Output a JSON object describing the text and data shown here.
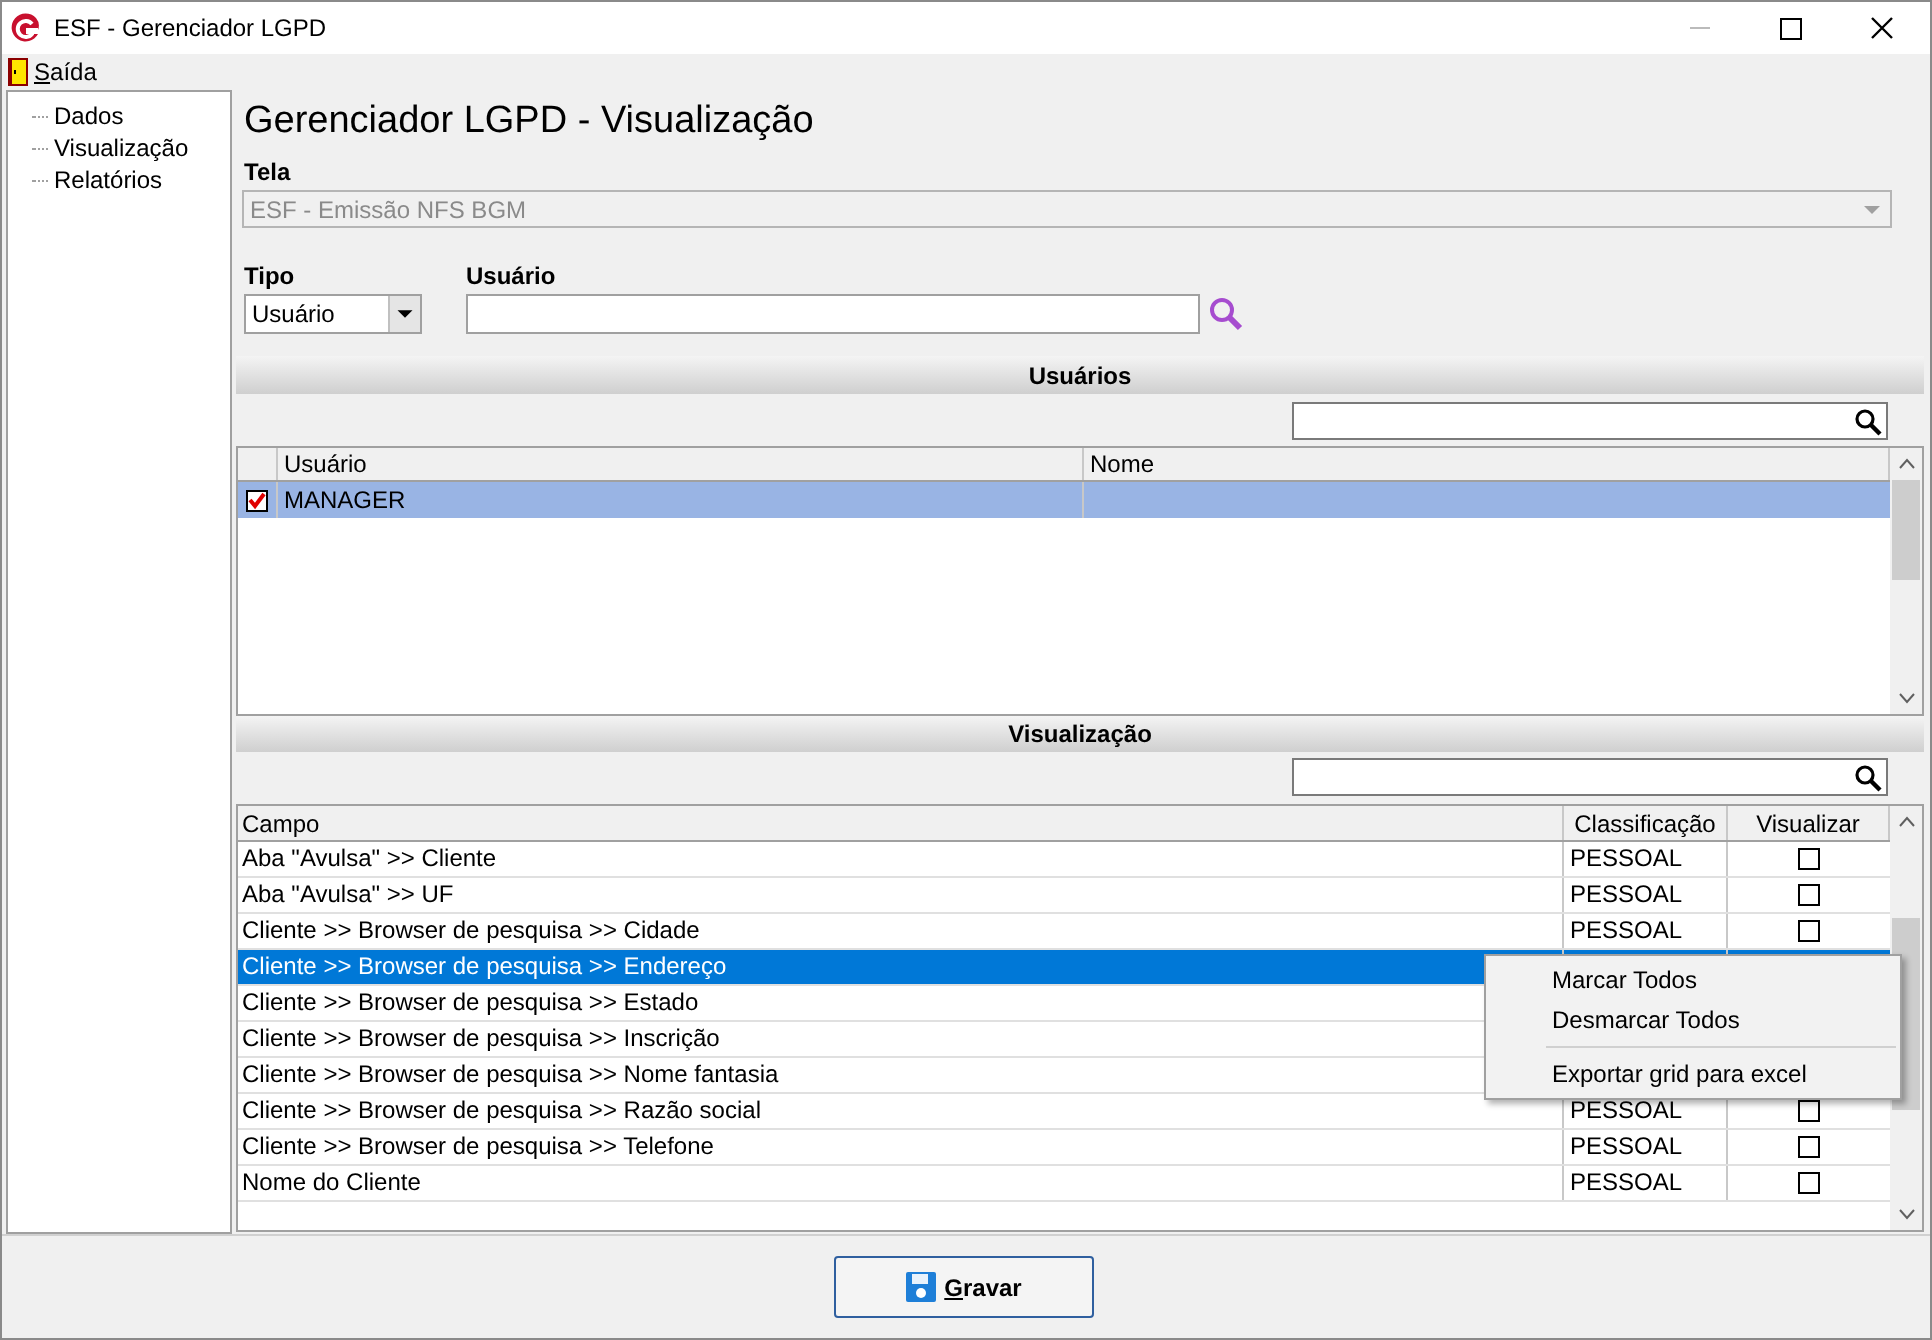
{
  "window": {
    "title": "ESF - Gerenciador LGPD"
  },
  "menu": [
    {
      "label": "Saída"
    }
  ],
  "sidebar": {
    "items": [
      {
        "label": "Dados"
      },
      {
        "label": "Visualização"
      },
      {
        "label": "Relatórios"
      }
    ]
  },
  "heading": "Gerenciador LGPD - Visualização",
  "tela": {
    "label": "Tela",
    "value": "ESF - Emissão NFS BGM",
    "disabled": true
  },
  "tipo": {
    "label": "Tipo",
    "value": "Usuário"
  },
  "usuario": {
    "label": "Usuário"
  },
  "usuarios_section": {
    "title": "Usuários",
    "columns": [
      "Usuário",
      "Nome"
    ],
    "rows": [
      {
        "usuario": "MANAGER",
        "checked": true,
        "selected": true
      }
    ]
  },
  "visualizacao_section": {
    "title": "Visualização",
    "columns": [
      "Campo",
      "Classificação",
      "Visualizar"
    ],
    "rows": [
      {
        "campo": "Aba \"Avulsa\" >> Cliente",
        "classificacao": "PESSOAL",
        "visualizar": false,
        "selected": false
      },
      {
        "campo": "Aba \"Avulsa\" >> UF",
        "classificacao": "PESSOAL",
        "visualizar": false,
        "selected": false
      },
      {
        "campo": "Cliente >> Browser de pesquisa >> Cidade",
        "classificacao": "PESSOAL",
        "visualizar": false,
        "selected": false
      },
      {
        "campo": "Cliente >> Browser de pesquisa >> Endereço",
        "selected": true
      },
      {
        "campo": "Cliente >> Browser de pesquisa >> Estado",
        "selected": false
      },
      {
        "campo": "Cliente >> Browser de pesquisa >> Inscrição",
        "selected": false
      },
      {
        "campo": "Cliente >> Browser de pesquisa >> Nome fantasia",
        "selected": false
      },
      {
        "campo": "Cliente >> Browser de pesquisa >> Razão social",
        "classificacao": "PESSOAL",
        "visualizar": false,
        "selected": false
      },
      {
        "campo": "Cliente >> Browser de pesquisa >> Telefone",
        "classificacao": "PESSOAL",
        "visualizar": false,
        "selected": false
      },
      {
        "campo": "Nome do Cliente",
        "classificacao": "PESSOAL",
        "visualizar": false,
        "selected": false
      }
    ]
  },
  "context_menu": {
    "items": [
      {
        "kind": "item",
        "label": "Marcar Todos"
      },
      {
        "kind": "item",
        "label": "Desmarcar Todos"
      },
      {
        "kind": "separator"
      },
      {
        "kind": "item",
        "label": "Exportar grid para excel"
      }
    ]
  },
  "buttons": [
    {
      "label": "Gravar"
    }
  ]
}
